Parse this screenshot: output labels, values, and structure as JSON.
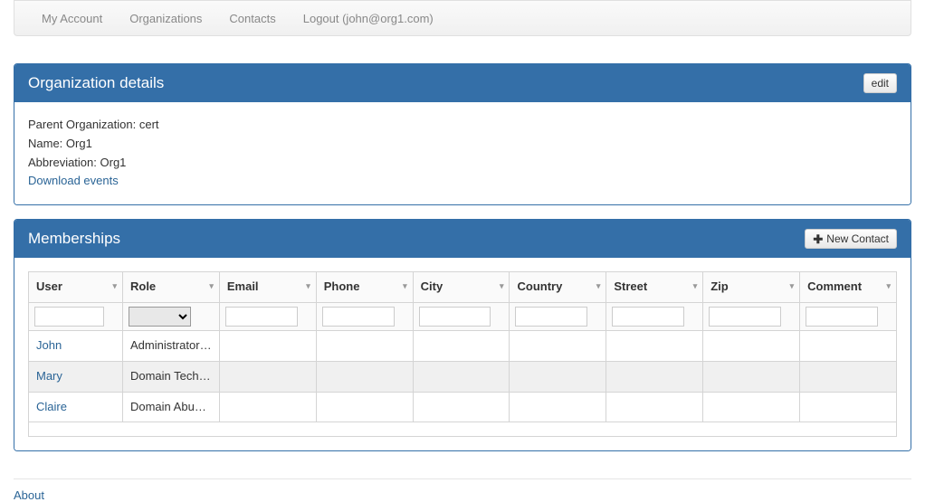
{
  "nav": {
    "my_account": "My Account",
    "organizations": "Organizations",
    "contacts": "Contacts",
    "logout": "Logout (john@org1.com)"
  },
  "org_details": {
    "title": "Organization details",
    "edit_label": "edit",
    "parent_label": "Parent Organization: ",
    "parent_value": "cert",
    "name_label": "Name: ",
    "name_value": "Org1",
    "abbr_label": "Abbreviation: ",
    "abbr_value": "Org1",
    "download_events": "Download events"
  },
  "memberships": {
    "title": "Memberships",
    "new_contact_label": "New Contact",
    "columns": {
      "user": "User",
      "role": "Role",
      "email": "Email",
      "phone": "Phone",
      "city": "City",
      "country": "Country",
      "street": "Street",
      "zip": "Zip",
      "comment": "Comment"
    },
    "rows": [
      {
        "user": "John",
        "role": "Administrator O...",
        "email": "",
        "phone": "",
        "city": "",
        "country": "",
        "street": "",
        "zip": "",
        "comment": ""
      },
      {
        "user": "Mary",
        "role": "Domain Techni...",
        "email": "",
        "phone": "",
        "city": "",
        "country": "",
        "street": "",
        "zip": "",
        "comment": ""
      },
      {
        "user": "Claire",
        "role": "Domain Abuse ...",
        "email": "",
        "phone": "",
        "city": "",
        "country": "",
        "street": "",
        "zip": "",
        "comment": ""
      }
    ]
  },
  "footer": {
    "about": "About"
  }
}
